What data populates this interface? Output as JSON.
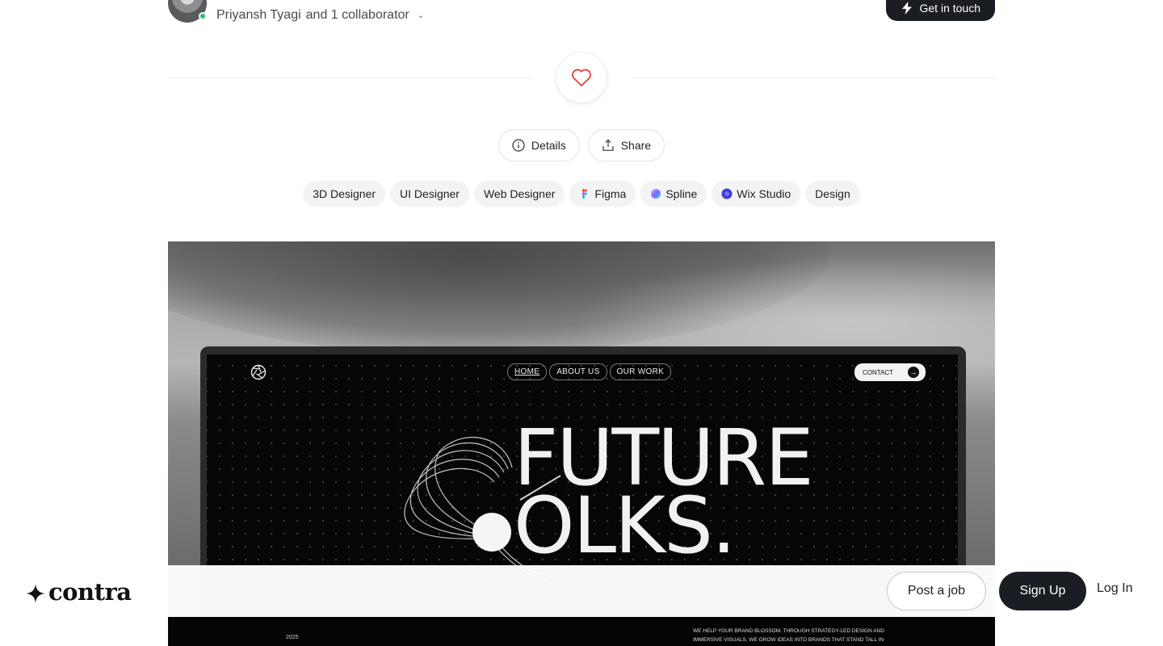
{
  "author": {
    "name": "Priyansh Tyagi",
    "collaborators": "and 1 collaborator",
    "online_color": "#27c26c"
  },
  "header": {
    "cta_label": "Get in touch"
  },
  "actions": {
    "details_label": "Details",
    "share_label": "Share"
  },
  "tags": [
    {
      "label": "3D Designer",
      "icon": ""
    },
    {
      "label": "UI Designer",
      "icon": ""
    },
    {
      "label": "Web Designer",
      "icon": ""
    },
    {
      "label": "Figma",
      "icon": "figma-icon"
    },
    {
      "label": "Spline",
      "icon": "spline-icon"
    },
    {
      "label": "Wix Studio",
      "icon": "wix-studio-icon"
    },
    {
      "label": "Design",
      "icon": ""
    }
  ],
  "hero": {
    "site_nav": [
      "HOME",
      "ABOUT US",
      "OUR WORK"
    ],
    "site_contact": "CONTACT",
    "headline_line1": "FUTURE",
    "headline_line2": "OLKS.",
    "year": "2025",
    "blurb": "We help your brand blossom. Through strategy-led design and immersive visuals, we grow ideas into brands that stand tall in"
  },
  "bottombar": {
    "brand": "contra",
    "post_job_label": "Post a job",
    "sign_up_label": "Sign Up",
    "log_in_label": "Log In"
  },
  "colors": {
    "dark": "#1b1d24",
    "like": "#e0453a"
  }
}
